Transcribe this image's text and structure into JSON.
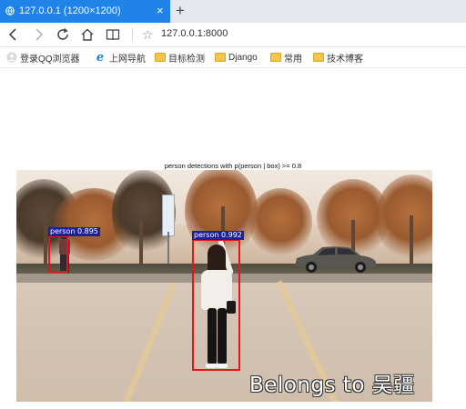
{
  "browser": {
    "tab": {
      "title": "127.0.0.1 (1200×1200)",
      "close_glyph": "×"
    },
    "new_tab_glyph": "+",
    "nav": {
      "back_icon": "back-arrow-icon",
      "forward_icon": "forward-arrow-icon",
      "reload_icon": "reload-icon",
      "home_icon": "home-icon",
      "reader_icon": "reader-icon",
      "star_glyph": "☆",
      "url": "127.0.0.1:8000"
    },
    "bookmarks": [
      {
        "label": "登录QQ浏览器",
        "icon": "user-icon"
      },
      {
        "label": "上网导航",
        "icon": "ie-icon"
      },
      {
        "label": "目标检测",
        "icon": "folder-icon"
      },
      {
        "label": "Django",
        "icon": "folder-icon"
      },
      {
        "label": "常用",
        "icon": "folder-icon"
      },
      {
        "label": "技术博客",
        "icon": "folder-icon"
      }
    ],
    "ie_glyph": "e",
    "colors": {
      "tab_active": "#1f83e8",
      "folder": "#f2c54b"
    }
  },
  "figure": {
    "title": "person detections with p(person | box) >= 0.8",
    "detections": [
      {
        "label": "person",
        "score": "0.895",
        "text": "person 0.895"
      },
      {
        "label": "person",
        "score": "0.992",
        "text": "person 0.992"
      }
    ],
    "watermark": "Belongs to 吴疆",
    "colors": {
      "box": "#e8141a",
      "label_bg": "#1e1f9c"
    }
  }
}
